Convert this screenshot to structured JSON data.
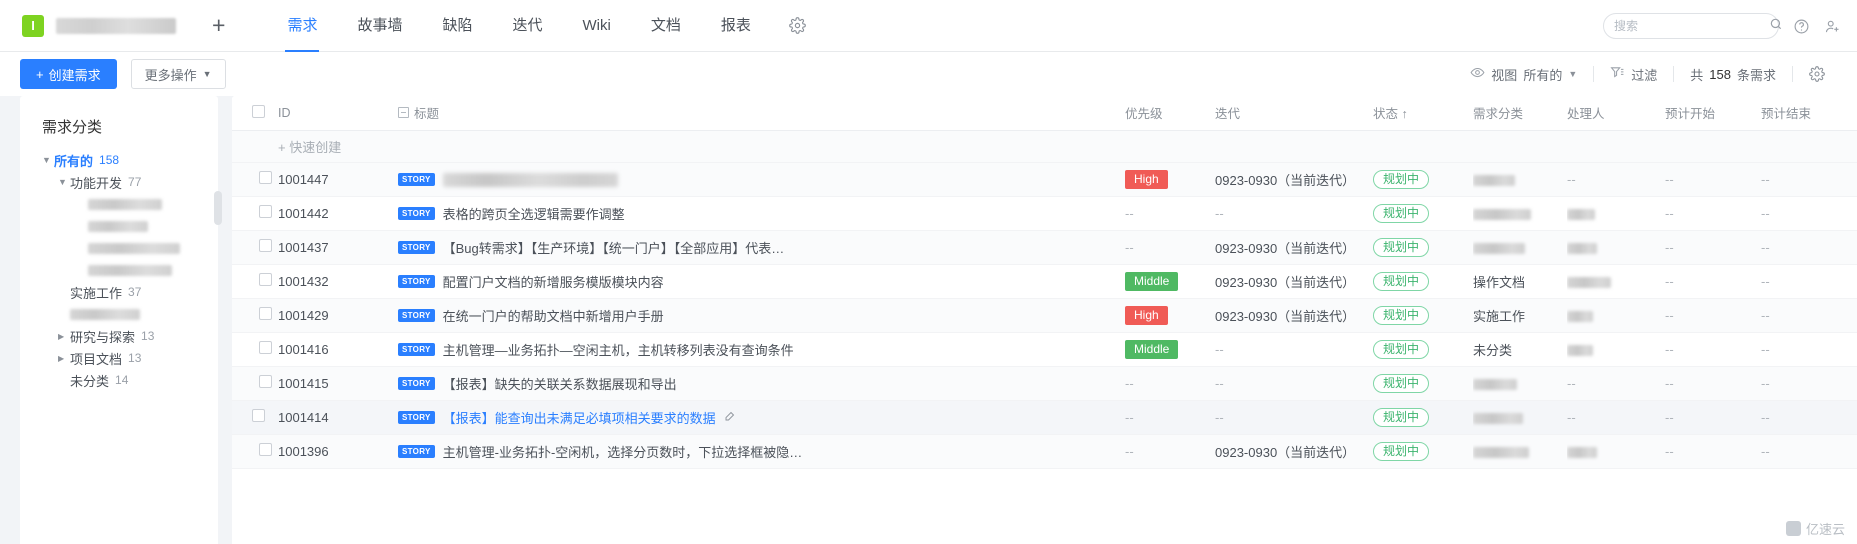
{
  "topbar": {
    "logo_letter": "I",
    "project_name_redacted": true,
    "add_label": "+",
    "nav": [
      {
        "label": "需求",
        "active": true
      },
      {
        "label": "故事墙",
        "active": false
      },
      {
        "label": "缺陷",
        "active": false
      },
      {
        "label": "迭代",
        "active": false
      },
      {
        "label": "Wiki",
        "active": false
      },
      {
        "label": "文档",
        "active": false
      },
      {
        "label": "报表",
        "active": false
      }
    ],
    "settings_icon": "gear-icon",
    "search": {
      "placeholder": "搜索",
      "value": ""
    },
    "help_icon": "help-circle-icon",
    "invite_icon": "add-user-icon"
  },
  "actionbar": {
    "create_label": "创建需求",
    "more_label": "更多操作",
    "view_icon_label": "视图",
    "view_value": "所有的",
    "filter_label": "过滤",
    "count_prefix": "共",
    "count_value": "158",
    "count_suffix": "条需求",
    "settings_icon": "gear-icon"
  },
  "sidebar": {
    "title": "需求分类",
    "tree": [
      {
        "label": "所有的",
        "count": "158",
        "level": 1,
        "caret": "down",
        "selected": true,
        "redacted": false
      },
      {
        "label": "功能开发",
        "count": "77",
        "level": 2,
        "caret": "down",
        "selected": false,
        "redacted": false
      },
      {
        "label": "",
        "count": "",
        "level": 3,
        "caret": "none",
        "selected": false,
        "redacted": true,
        "blur_width": 74
      },
      {
        "label": "",
        "count": "",
        "level": 3,
        "caret": "none",
        "selected": false,
        "redacted": true,
        "blur_width": 60
      },
      {
        "label": "",
        "count": "",
        "level": 3,
        "caret": "none",
        "selected": false,
        "redacted": true,
        "blur_width": 92
      },
      {
        "label": "",
        "count": "",
        "level": 3,
        "caret": "none",
        "selected": false,
        "redacted": true,
        "blur_width": 84
      },
      {
        "label": "实施工作",
        "count": "37",
        "level": 2,
        "caret": "none",
        "selected": false,
        "redacted": false
      },
      {
        "label": "",
        "count": "",
        "level": 2,
        "caret": "none",
        "selected": false,
        "redacted": true,
        "blur_width": 70
      },
      {
        "label": "研究与探索",
        "count": "13",
        "level": 2,
        "caret": "right",
        "selected": false,
        "redacted": false
      },
      {
        "label": "项目文档",
        "count": "13",
        "level": 2,
        "caret": "right",
        "selected": false,
        "redacted": false
      },
      {
        "label": "未分类",
        "count": "14",
        "level": 2,
        "caret": "none",
        "selected": false,
        "redacted": false
      }
    ]
  },
  "table": {
    "columns": [
      {
        "key": "check",
        "label": ""
      },
      {
        "key": "id",
        "label": "ID"
      },
      {
        "key": "title",
        "label": "标题",
        "has_collapse_icon": true
      },
      {
        "key": "priority",
        "label": "优先级"
      },
      {
        "key": "iteration",
        "label": "迭代"
      },
      {
        "key": "status",
        "label": "状态 ↑"
      },
      {
        "key": "category",
        "label": "需求分类"
      },
      {
        "key": "owner",
        "label": "处理人"
      },
      {
        "key": "start",
        "label": "预计开始"
      },
      {
        "key": "end",
        "label": "预计结束"
      }
    ],
    "quick_create_label": "快速创建",
    "rows": [
      {
        "id": "1001447",
        "tag": "STORY",
        "title": "",
        "title_redacted": true,
        "title_blur_width": 175,
        "priority": "High",
        "priority_kind": "high",
        "iteration": "0923-0930（当前迭代）",
        "status": "规划中",
        "category": "",
        "category_redacted": true,
        "category_blur_width": 42,
        "owner": "--",
        "owner_redacted": false,
        "start": "--",
        "end": "--",
        "highlight": false,
        "title_link": false,
        "has_edit_icon": false,
        "show_menu": false
      },
      {
        "id": "1001442",
        "tag": "STORY",
        "title": "表格的跨页全选逻辑需要作调整",
        "title_redacted": false,
        "priority": "--",
        "priority_kind": "none",
        "iteration": "--",
        "status": "规划中",
        "category": "",
        "category_redacted": true,
        "category_blur_width": 58,
        "owner": "",
        "owner_redacted": true,
        "owner_blur_width": 28,
        "start": "--",
        "end": "--",
        "highlight": false,
        "title_link": false,
        "has_edit_icon": false,
        "show_menu": false
      },
      {
        "id": "1001437",
        "tag": "STORY",
        "title": "【Bug转需求】【生产环境】【统一门户】【全部应用】代表…",
        "title_redacted": false,
        "priority": "--",
        "priority_kind": "none",
        "iteration": "0923-0930（当前迭代）",
        "status": "规划中",
        "category": "",
        "category_redacted": true,
        "category_blur_width": 52,
        "owner": "",
        "owner_redacted": true,
        "owner_blur_width": 30,
        "start": "--",
        "end": "--",
        "highlight": false,
        "title_link": false,
        "has_edit_icon": false,
        "show_menu": false
      },
      {
        "id": "1001432",
        "tag": "STORY",
        "title": "配置门户文档的新增服务模版模块内容",
        "title_redacted": false,
        "priority": "Middle",
        "priority_kind": "middle",
        "iteration": "0923-0930（当前迭代）",
        "status": "规划中",
        "category": "操作文档",
        "category_redacted": false,
        "owner": "",
        "owner_redacted": true,
        "owner_blur_width": 44,
        "start": "--",
        "end": "--",
        "highlight": false,
        "title_link": false,
        "has_edit_icon": false,
        "show_menu": false
      },
      {
        "id": "1001429",
        "tag": "STORY",
        "title": "在统一门户的帮助文档中新增用户手册",
        "title_redacted": false,
        "priority": "High",
        "priority_kind": "high",
        "iteration": "0923-0930（当前迭代）",
        "status": "规划中",
        "category": "实施工作",
        "category_redacted": false,
        "owner": "",
        "owner_redacted": true,
        "owner_blur_width": 26,
        "start": "--",
        "end": "--",
        "highlight": false,
        "title_link": false,
        "has_edit_icon": false,
        "show_menu": false
      },
      {
        "id": "1001416",
        "tag": "STORY",
        "title": "主机管理—业务拓扑—空闲主机，主机转移列表没有查询条件",
        "title_redacted": false,
        "priority": "Middle",
        "priority_kind": "middle",
        "iteration": "--",
        "status": "规划中",
        "category": "未分类",
        "category_redacted": false,
        "owner": "",
        "owner_redacted": true,
        "owner_blur_width": 26,
        "start": "--",
        "end": "--",
        "highlight": false,
        "title_link": false,
        "has_edit_icon": false,
        "show_menu": false
      },
      {
        "id": "1001415",
        "tag": "STORY",
        "title": "【报表】缺失的关联关系数据展现和导出",
        "title_redacted": false,
        "priority": "--",
        "priority_kind": "none",
        "iteration": "--",
        "status": "规划中",
        "category": "",
        "category_redacted": true,
        "category_blur_width": 44,
        "owner": "--",
        "owner_redacted": false,
        "start": "--",
        "end": "--",
        "highlight": false,
        "title_link": false,
        "has_edit_icon": false,
        "show_menu": false
      },
      {
        "id": "1001414",
        "tag": "STORY",
        "title": "【报表】能查询出未满足必填项相关要求的数据",
        "title_redacted": false,
        "priority": "--",
        "priority_kind": "none",
        "iteration": "--",
        "status": "规划中",
        "category": "",
        "category_redacted": true,
        "category_blur_width": 50,
        "owner": "--",
        "owner_redacted": false,
        "start": "--",
        "end": "--",
        "highlight": true,
        "title_link": true,
        "has_edit_icon": true,
        "show_menu": true
      },
      {
        "id": "1001396",
        "tag": "STORY",
        "title": "主机管理-业务拓扑-空闲机，选择分页数时，下拉选择框被隐…",
        "title_redacted": false,
        "priority": "--",
        "priority_kind": "none",
        "iteration": "0923-0930（当前迭代）",
        "status": "规划中",
        "category": "",
        "category_redacted": true,
        "category_blur_width": 56,
        "owner": "",
        "owner_redacted": true,
        "owner_blur_width": 30,
        "start": "--",
        "end": "--",
        "highlight": false,
        "title_link": false,
        "has_edit_icon": false,
        "show_menu": false
      }
    ]
  },
  "watermark": {
    "text": "亿速云"
  }
}
